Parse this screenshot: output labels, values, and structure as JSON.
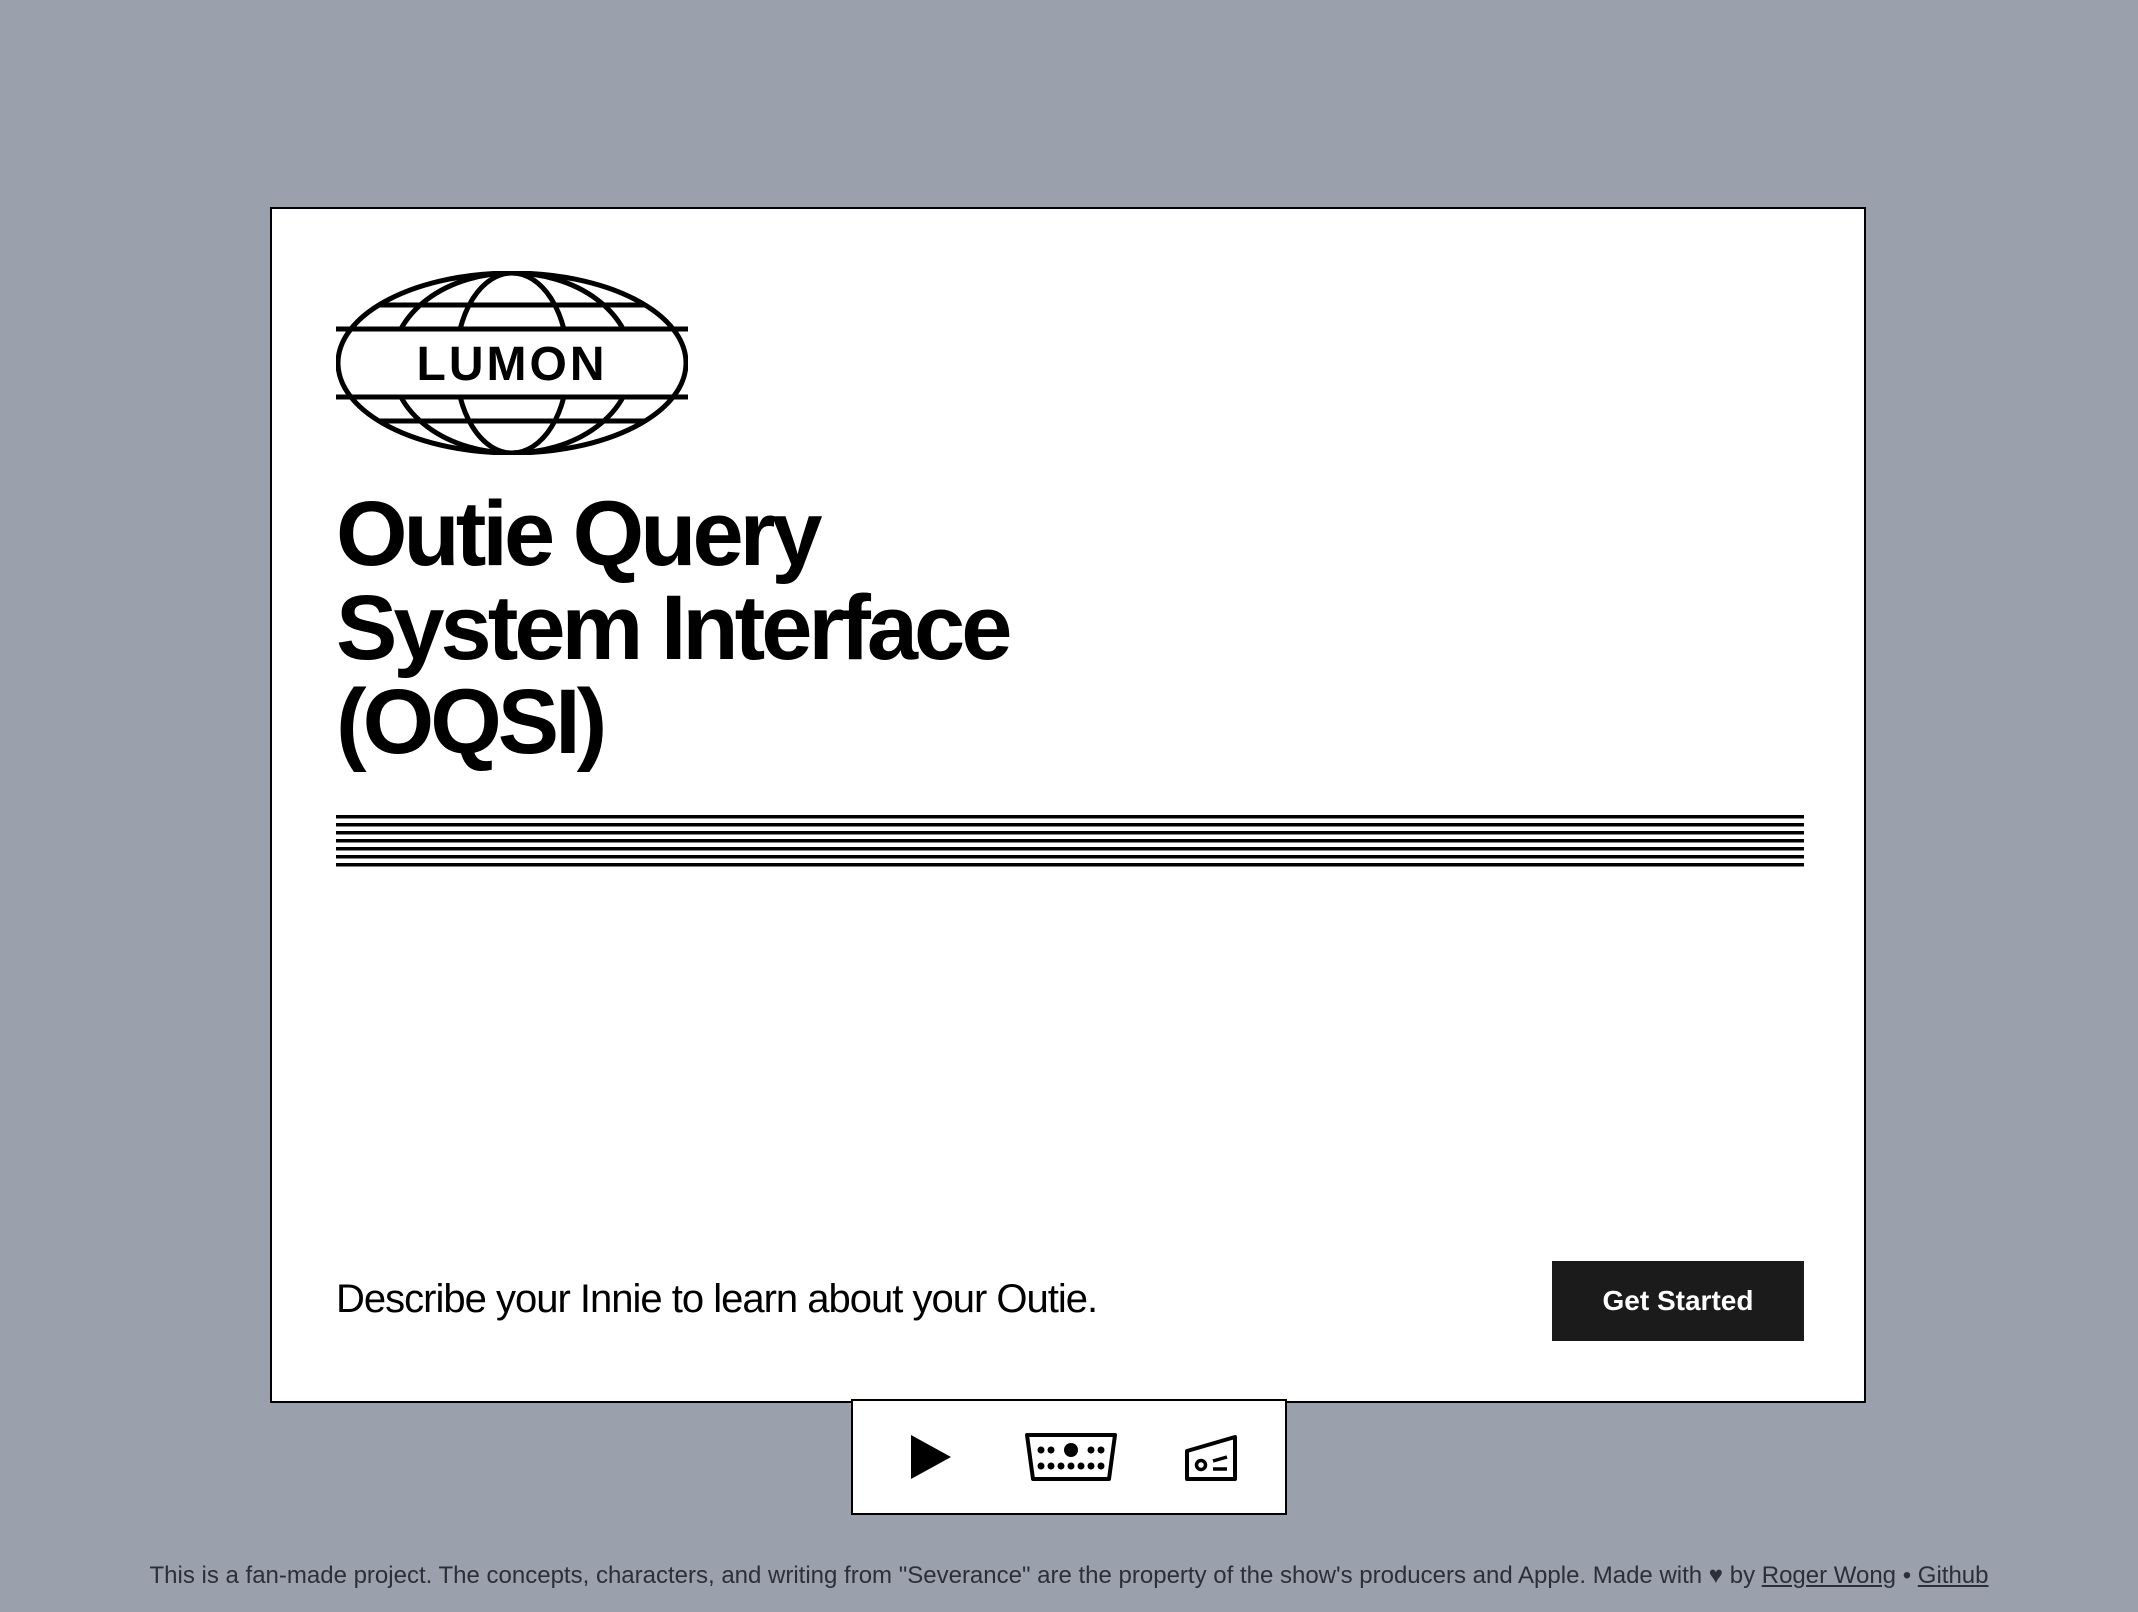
{
  "logo": {
    "text": "LUMON",
    "icon": "lumon-globe-logo"
  },
  "title": "Outie Query\nSystem Interface\n(OQSI)",
  "tagline": "Describe your Innie to learn about your Outie.",
  "get_started_label": "Get Started",
  "toolbar": {
    "items": [
      {
        "icon": "play-icon"
      },
      {
        "icon": "keyboard-icon"
      },
      {
        "icon": "camera-icon"
      }
    ]
  },
  "footer": {
    "text": "This is a fan-made project. The concepts, characters, and writing from \"Severance\" are the property of the show's producers and Apple. Made with ♥ by",
    "author_link": "Roger Wong",
    "separator": "•",
    "github_link": "Github"
  },
  "colors": {
    "background": "#9aa1ac",
    "card": "#ffffff",
    "button": "#1b1b1b",
    "text": "#000000"
  }
}
